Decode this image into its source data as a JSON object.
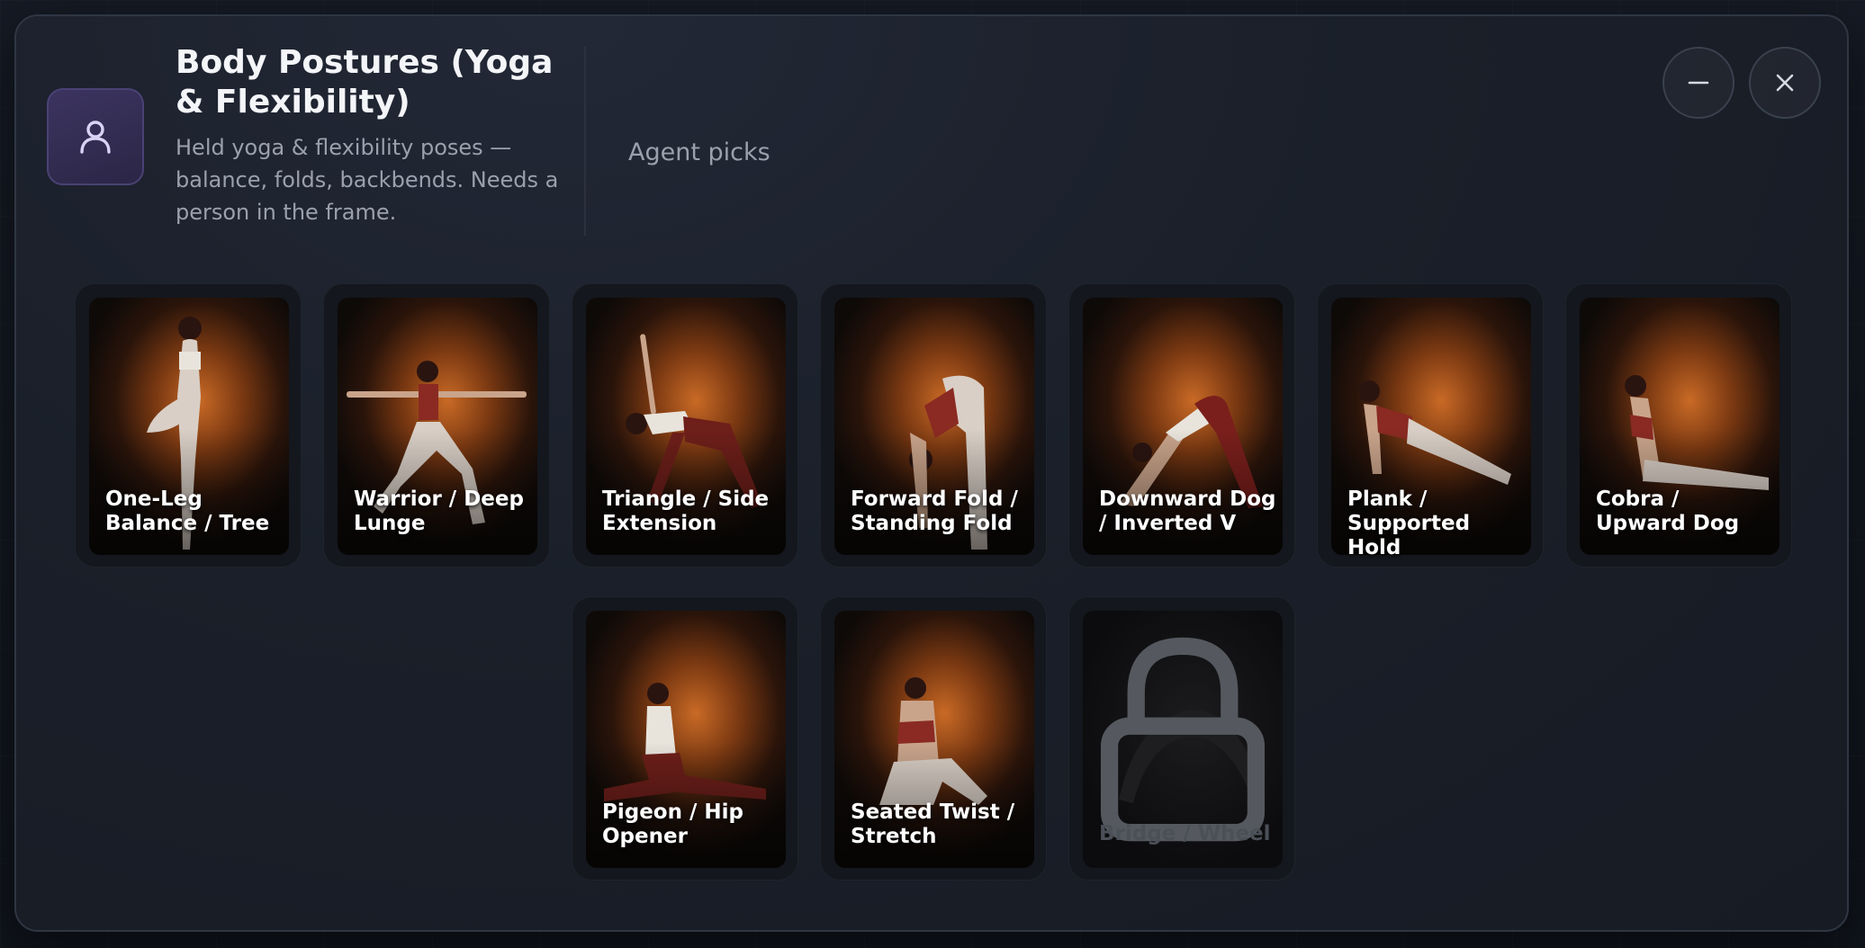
{
  "dialog": {
    "title": "Body Postures (Yoga & Flexibility)",
    "description": "Held yoga & flexibility poses — balance, folds, backbends. Needs a person in the frame.",
    "agent_picks_label": "Agent picks",
    "icon": "person-icon"
  },
  "controls": {
    "minimize_icon": "minus-icon",
    "close_icon": "close-icon"
  },
  "colors": {
    "icon_tile": "#3c3460",
    "glow": "#c96a26",
    "modal_bg": "#1a1f29"
  },
  "poses": [
    {
      "label": "One-Leg Balance / Tree",
      "locked": false
    },
    {
      "label": "Warrior / Deep Lunge",
      "locked": false
    },
    {
      "label": "Triangle / Side Extension",
      "locked": false
    },
    {
      "label": "Forward Fold / Standing Fold",
      "locked": false
    },
    {
      "label": "Downward Dog / Inverted V",
      "locked": false
    },
    {
      "label": "Plank / Supported Hold",
      "locked": false
    },
    {
      "label": "Cobra / Upward Dog",
      "locked": false
    },
    {
      "label": "Pigeon / Hip Opener",
      "locked": false
    },
    {
      "label": "Seated Twist / Stretch",
      "locked": false
    },
    {
      "label": "Bridge / Wheel",
      "locked": true
    }
  ]
}
